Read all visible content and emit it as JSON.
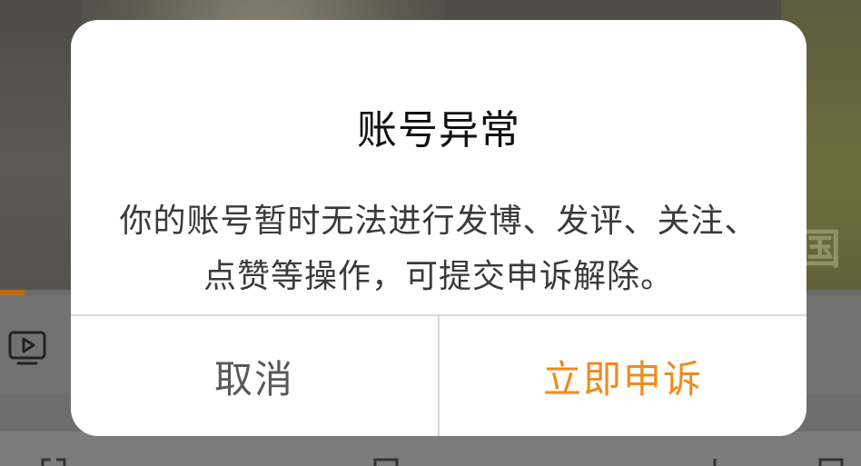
{
  "dialog": {
    "title": "账号异常",
    "message": "你的账号暂时无法进行发博、发评、关注、点赞等操作，可提交申诉解除。",
    "cancel_label": "取消",
    "appeal_label": "立即申诉"
  },
  "background": {
    "video_progress": 0.028,
    "icons": [
      "tv-icon"
    ]
  },
  "colors": {
    "accent": "#f08a1c",
    "overlay": "#7a7a7a",
    "dialog_bg": "#ffffff",
    "title_text": "#111111",
    "message_text": "#3a3a3a",
    "cancel_text": "#585858",
    "progress": "#b86b16"
  }
}
